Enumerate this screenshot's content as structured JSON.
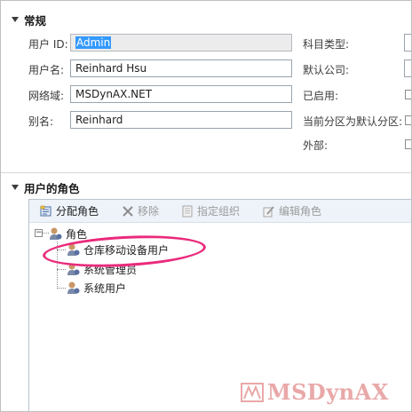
{
  "general": {
    "section_title": "常规",
    "user_id_label": "用户 ID:",
    "user_id_value": "Admin",
    "user_name_label": "用户名:",
    "user_name_value": "Reinhard Hsu",
    "domain_label": "网络域:",
    "domain_value": "MSDynAX.NET",
    "alias_label": "别名:",
    "alias_value": "Reinhard",
    "account_type_label": "科目类型:",
    "default_company_label": "默认公司:",
    "enabled_label": "已启用:",
    "default_partition_label": "当前分区为默认分区:",
    "external_label": "外部:"
  },
  "roles": {
    "section_title": "用户的角色",
    "toolbar": {
      "assign_label": "分配角色",
      "remove_label": "移除",
      "specify_org_label": "指定组织",
      "edit_label": "编辑角色"
    },
    "tree": {
      "root_label": "角色",
      "expander_symbol": "−",
      "items": [
        {
          "label": "仓库移动设备用户"
        },
        {
          "label": "系统管理员"
        },
        {
          "label": "系统用户"
        }
      ]
    }
  },
  "watermark": {
    "text": "MSDynAX"
  },
  "colors": {
    "highlight": "#ea2a7b",
    "selection": "#3399ff",
    "toolbar_bg": "#eef3f9",
    "watermark": "#e9a8a8"
  }
}
